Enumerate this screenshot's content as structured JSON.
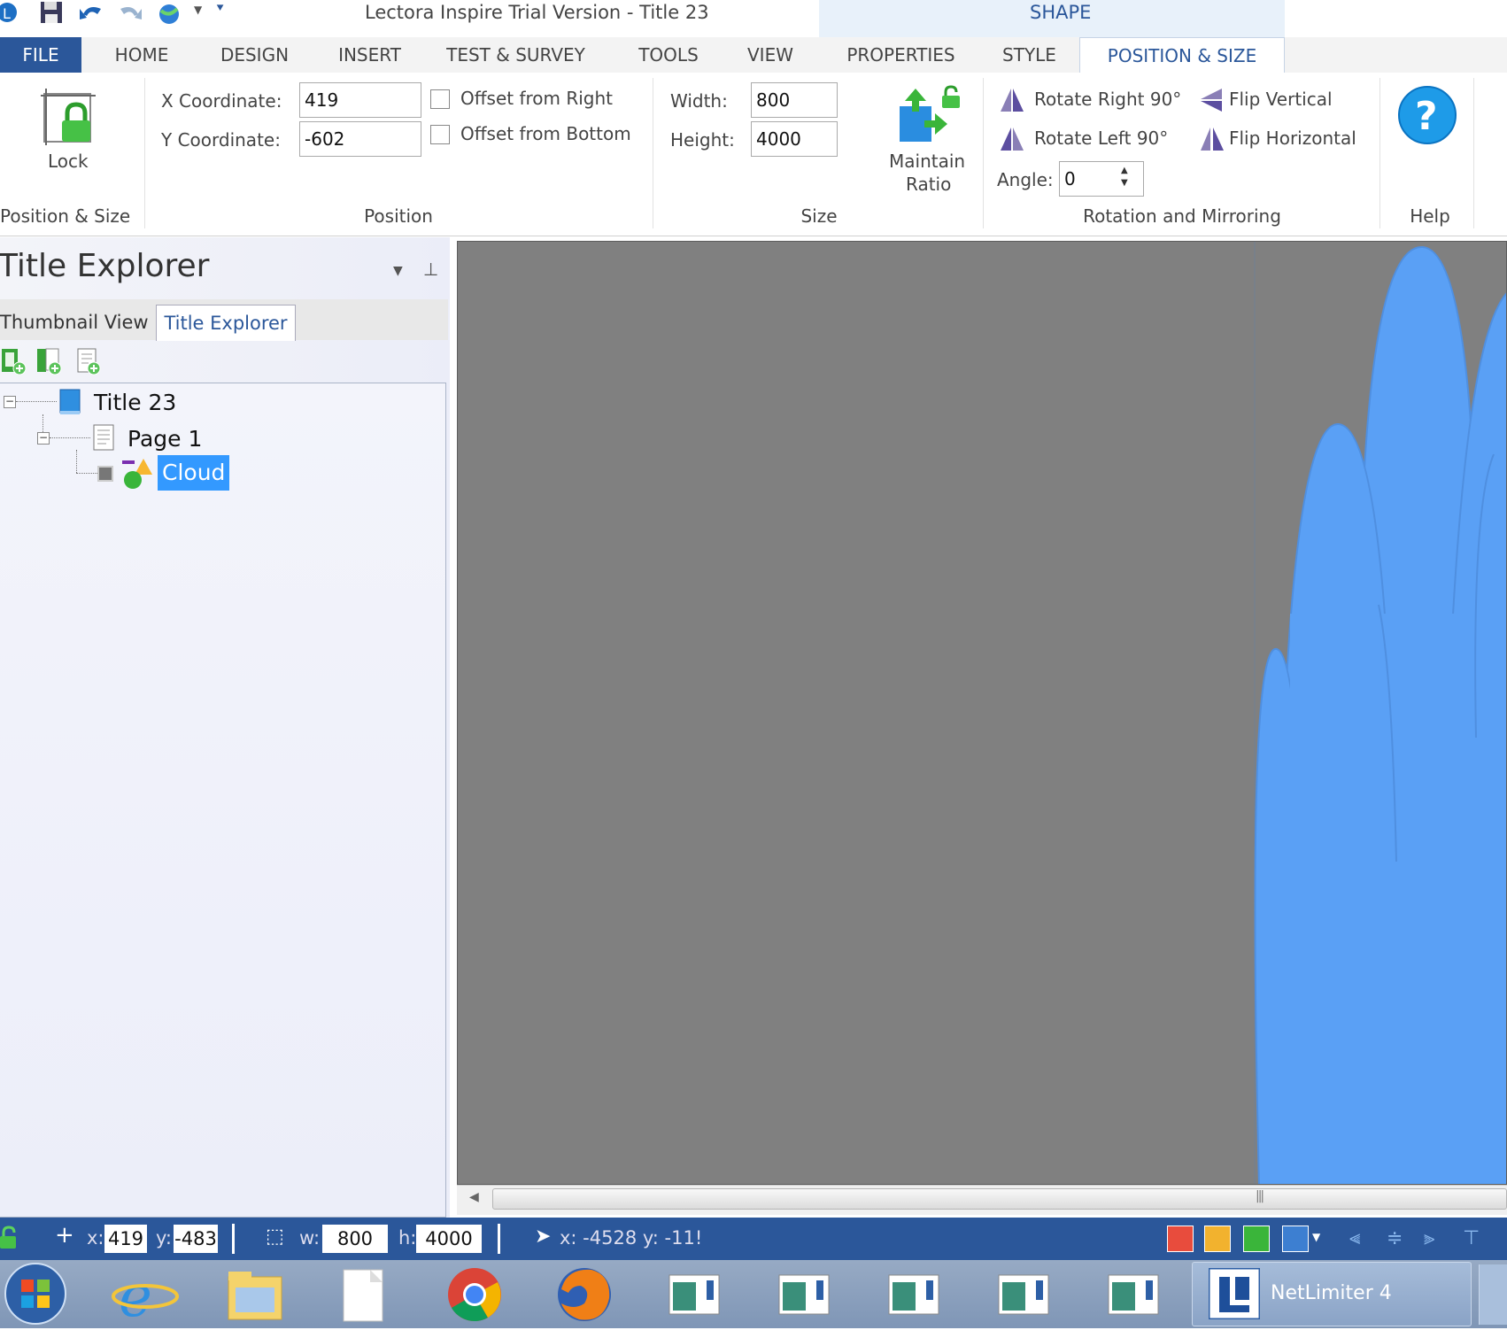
{
  "window_title": "Lectora Inspire Trial Version - Title 23",
  "context_tab_group": "SHAPE",
  "tabs": {
    "file": "FILE",
    "home": "HOME",
    "design": "DESIGN",
    "insert": "INSERT",
    "test_survey": "TEST & SURVEY",
    "tools": "TOOLS",
    "view": "VIEW",
    "properties": "PROPERTIES",
    "style": "STYLE",
    "position_size": "POSITION & SIZE"
  },
  "ribbon": {
    "lock_group": {
      "lock_label": "Lock",
      "group_label": "Position & Size"
    },
    "position": {
      "x_label": "X Coordinate:",
      "x_value": "419",
      "y_label": "Y Coordinate:",
      "y_value": "-602",
      "offset_right_label": "Offset from Right",
      "offset_right_checked": false,
      "offset_bottom_label": "Offset from Bottom",
      "offset_bottom_checked": false,
      "group_label": "Position"
    },
    "size": {
      "width_label": "Width:",
      "width_value": "800",
      "height_label": "Height:",
      "height_value": "4000",
      "maintain_ratio_line1": "Maintain",
      "maintain_ratio_line2": "Ratio",
      "group_label": "Size"
    },
    "rotation": {
      "rotate_right": "Rotate Right 90°",
      "rotate_left": "Rotate Left 90°",
      "flip_vertical": "Flip Vertical",
      "flip_horizontal": "Flip Horizontal",
      "angle_label": "Angle:",
      "angle_value": "0",
      "group_label": "Rotation and Mirroring"
    },
    "help": {
      "group_label": "Help"
    }
  },
  "left_panel": {
    "title": "Title Explorer",
    "subtabs": [
      "Thumbnail View",
      "Title Explorer"
    ],
    "active_subtab": "Title Explorer",
    "tree": {
      "title": "Title 23",
      "page": "Page 1",
      "object": "Cloud"
    }
  },
  "status_bar": {
    "x_label": "x:",
    "x_value": "419",
    "y_label": "y:",
    "y_value": "-483",
    "w_label": "w:",
    "w_value": "800",
    "h_label": "h:",
    "h_value": "4000",
    "cursor_readout": "x: -4528  y: -11!"
  },
  "taskbar": {
    "netlimiter_label": "NetLimiter 4"
  },
  "colors": {
    "accent": "#2b579a",
    "cloud": "#5aa0f5",
    "canvas": "#808080",
    "selection": "#3399ff"
  }
}
